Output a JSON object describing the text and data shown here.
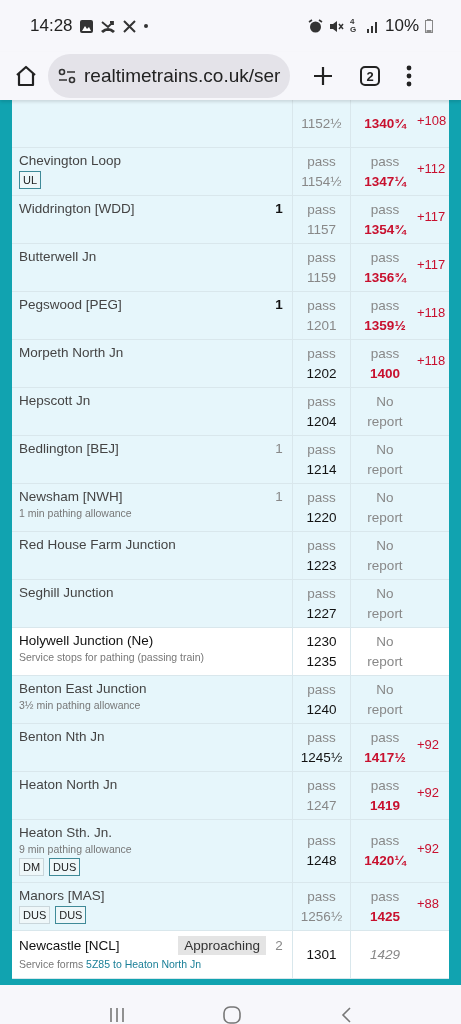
{
  "status_bar": {
    "time": "14:28",
    "network": "4G",
    "battery": "10%"
  },
  "browser": {
    "url": "realtimetrains.co.uk/ser",
    "tab_count": "2"
  },
  "rows": [
    {
      "kind": "pass",
      "sched": {
        "time": "1152½",
        "dim": true
      },
      "actual": {
        "kind": "late",
        "time": "1340¾"
      },
      "delay": "+108"
    },
    {
      "kind": "pass",
      "name": "Chevington Loop",
      "tags": [
        {
          "label": "UL",
          "outlined": true
        }
      ],
      "sched": {
        "label": "pass",
        "time": "1154½",
        "dim": true
      },
      "actual": {
        "kind": "late",
        "label": "pass",
        "time": "1347¼"
      },
      "delay": "+112"
    },
    {
      "kind": "pass",
      "name": "Widdrington [WDD]",
      "platform": {
        "text": "1",
        "confirmed": true
      },
      "sched": {
        "label": "pass",
        "time": "1157",
        "dim": true
      },
      "actual": {
        "kind": "late",
        "label": "pass",
        "time": "1354¾"
      },
      "delay": "+117"
    },
    {
      "kind": "pass",
      "name": "Butterwell Jn",
      "sched": {
        "label": "pass",
        "time": "1159",
        "dim": true
      },
      "actual": {
        "kind": "late",
        "label": "pass",
        "time": "1356¾"
      },
      "delay": "+117"
    },
    {
      "kind": "pass",
      "name": "Pegswood [PEG]",
      "platform": {
        "text": "1",
        "confirmed": true
      },
      "sched": {
        "label": "pass",
        "time": "1201",
        "dim": true
      },
      "actual": {
        "kind": "late",
        "label": "pass",
        "time": "1359½"
      },
      "delay": "+118"
    },
    {
      "kind": "pass",
      "name": "Morpeth North Jn",
      "sched": {
        "label": "pass",
        "time": "1202",
        "dim": false
      },
      "actual": {
        "kind": "late",
        "label": "pass",
        "time": "1400"
      },
      "delay": "+118"
    },
    {
      "kind": "pass",
      "name": "Hepscott Jn",
      "sched": {
        "label": "pass",
        "time": "1204",
        "dim": false
      },
      "actual": {
        "kind": "none",
        "label": "No",
        "time": "report"
      }
    },
    {
      "kind": "pass",
      "name": "Bedlington [BEJ]",
      "platform": {
        "text": "1",
        "confirmed": false
      },
      "sched": {
        "label": "pass",
        "time": "1214",
        "dim": false
      },
      "actual": {
        "kind": "none",
        "label": "No",
        "time": "report"
      }
    },
    {
      "kind": "pass",
      "name": "Newsham [NWH]",
      "platform": {
        "text": "1",
        "confirmed": false
      },
      "note": "1 min pathing allowance",
      "sched": {
        "label": "pass",
        "time": "1220",
        "dim": false
      },
      "actual": {
        "kind": "none",
        "label": "No",
        "time": "report"
      }
    },
    {
      "kind": "pass",
      "name": "Red House Farm Junction",
      "sched": {
        "label": "pass",
        "time": "1223",
        "dim": false
      },
      "actual": {
        "kind": "none",
        "label": "No",
        "time": "report"
      }
    },
    {
      "kind": "pass",
      "name": "Seghill Junction",
      "sched": {
        "label": "pass",
        "time": "1227",
        "dim": false
      },
      "actual": {
        "kind": "none",
        "label": "No",
        "time": "report"
      }
    },
    {
      "kind": "stop",
      "name": "Holywell Junction (Ne)",
      "note": "Service stops for pathing (passing train)",
      "sched": {
        "label": "1230",
        "time": "1235",
        "dim": false
      },
      "actual": {
        "kind": "none",
        "label": "No",
        "time": "report"
      }
    },
    {
      "kind": "pass",
      "name": "Benton East Junction",
      "note": "3½ min pathing allowance",
      "sched": {
        "label": "pass",
        "time": "1240",
        "dim": false
      },
      "actual": {
        "kind": "none",
        "label": "No",
        "time": "report"
      }
    },
    {
      "kind": "pass",
      "name": "Benton Nth Jn",
      "sched": {
        "label": "pass",
        "time": "1245½",
        "dim": false
      },
      "actual": {
        "kind": "late",
        "label": "pass",
        "time": "1417½"
      },
      "delay": "+92"
    },
    {
      "kind": "pass",
      "name": "Heaton North Jn",
      "sched": {
        "label": "pass",
        "time": "1247",
        "dim": true
      },
      "actual": {
        "kind": "late",
        "label": "pass",
        "time": "1419"
      },
      "delay": "+92"
    },
    {
      "kind": "pass",
      "name": "Heaton Sth. Jn.",
      "note": "9 min pathing allowance",
      "tags": [
        {
          "label": "DM",
          "outlined": false
        },
        {
          "label": "DUS",
          "outlined": true
        }
      ],
      "sched": {
        "label": "pass",
        "time": "1248",
        "dim": false
      },
      "actual": {
        "kind": "late",
        "label": "pass",
        "time": "1420¼"
      },
      "delay": "+92"
    },
    {
      "kind": "pass",
      "name": "Manors [MAS]",
      "tags": [
        {
          "label": "DUS",
          "outlined": false
        },
        {
          "label": "DUS",
          "outlined": true
        }
      ],
      "sched": {
        "label": "pass",
        "time": "1256½",
        "dim": true
      },
      "actual": {
        "kind": "late",
        "label": "pass",
        "time": "1425"
      },
      "delay": "+88"
    },
    {
      "kind": "stop",
      "name": "Newcastle [NCL]",
      "badge": "Approaching",
      "platform": {
        "text": "2",
        "confirmed": false
      },
      "note": "Service forms ",
      "link": "5Z85 to Heaton North Jn",
      "sched": {
        "label": "1301"
      },
      "actual": {
        "kind": "expected",
        "label": "1429"
      }
    }
  ]
}
